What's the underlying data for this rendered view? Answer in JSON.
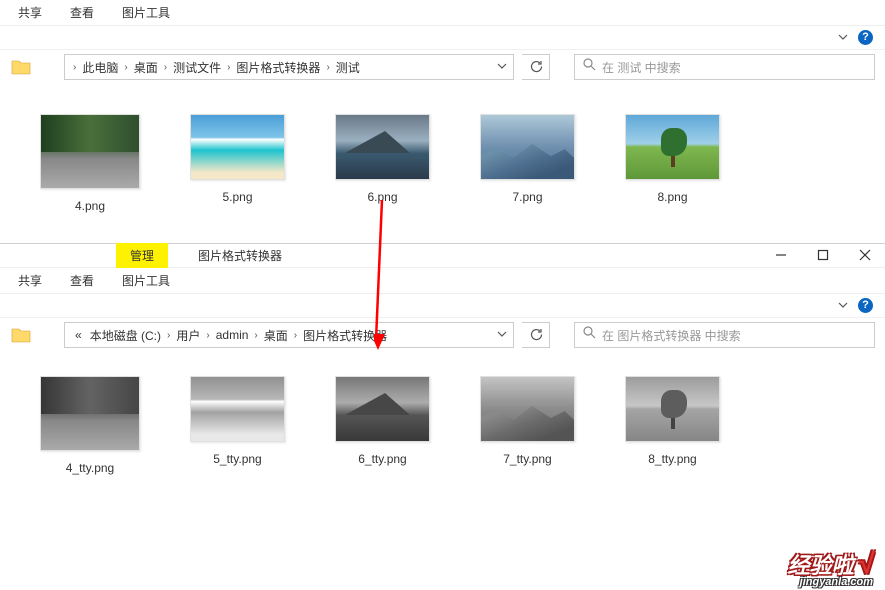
{
  "top_window": {
    "tabs": {
      "share": "共享",
      "view": "查看",
      "tools": "图片工具"
    },
    "breadcrumb": [
      "此电脑",
      "桌面",
      "测试文件",
      "图片格式转换器",
      "测试"
    ],
    "breadcrumb_prefix": "›",
    "search_placeholder": "在 测试 中搜索",
    "files": [
      {
        "name": "4.png",
        "scene": "scene-river"
      },
      {
        "name": "5.png",
        "scene": "scene-beach"
      },
      {
        "name": "6.png",
        "scene": "scene-lake"
      },
      {
        "name": "7.png",
        "scene": "scene-mtn"
      },
      {
        "name": "8.png",
        "scene": "scene-tree"
      }
    ]
  },
  "bottom_window": {
    "manage_tab": "管理",
    "title": "图片格式转换器",
    "tabs": {
      "share": "共享",
      "view": "查看",
      "tools": "图片工具"
    },
    "breadcrumb_prefix": "«",
    "breadcrumb": [
      "本地磁盘 (C:)",
      "用户",
      "admin",
      "桌面",
      "图片格式转换器"
    ],
    "search_placeholder": "在 图片格式转换器 中搜索",
    "files": [
      {
        "name": "4_tty.png",
        "scene": "scene-river"
      },
      {
        "name": "5_tty.png",
        "scene": "scene-beach"
      },
      {
        "name": "6_tty.png",
        "scene": "scene-lake"
      },
      {
        "name": "7_tty.png",
        "scene": "scene-mtn"
      },
      {
        "name": "8_tty.png",
        "scene": "scene-tree"
      }
    ]
  },
  "watermark": {
    "main": "经验啦",
    "sub": "jingyanla.com"
  }
}
